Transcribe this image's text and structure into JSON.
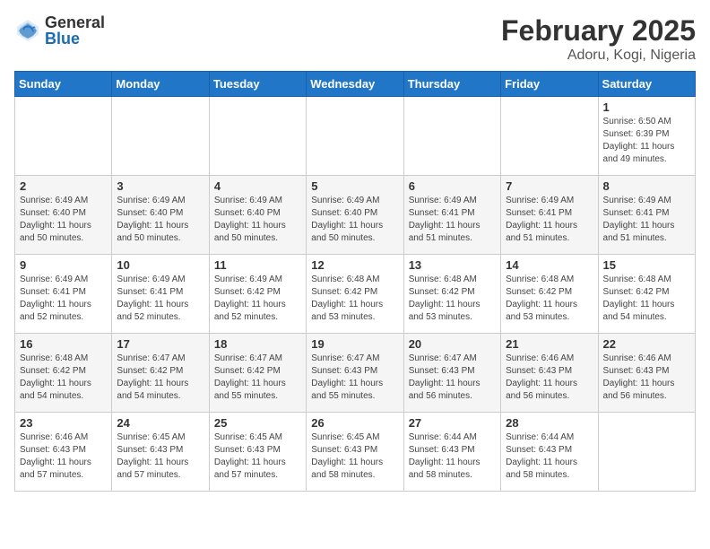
{
  "header": {
    "logo_general": "General",
    "logo_blue": "Blue",
    "month_year": "February 2025",
    "location": "Adoru, Kogi, Nigeria"
  },
  "days_of_week": [
    "Sunday",
    "Monday",
    "Tuesday",
    "Wednesday",
    "Thursday",
    "Friday",
    "Saturday"
  ],
  "weeks": [
    [
      {
        "day": "",
        "info": ""
      },
      {
        "day": "",
        "info": ""
      },
      {
        "day": "",
        "info": ""
      },
      {
        "day": "",
        "info": ""
      },
      {
        "day": "",
        "info": ""
      },
      {
        "day": "",
        "info": ""
      },
      {
        "day": "1",
        "info": "Sunrise: 6:50 AM\nSunset: 6:39 PM\nDaylight: 11 hours\nand 49 minutes."
      }
    ],
    [
      {
        "day": "2",
        "info": "Sunrise: 6:49 AM\nSunset: 6:40 PM\nDaylight: 11 hours\nand 50 minutes."
      },
      {
        "day": "3",
        "info": "Sunrise: 6:49 AM\nSunset: 6:40 PM\nDaylight: 11 hours\nand 50 minutes."
      },
      {
        "day": "4",
        "info": "Sunrise: 6:49 AM\nSunset: 6:40 PM\nDaylight: 11 hours\nand 50 minutes."
      },
      {
        "day": "5",
        "info": "Sunrise: 6:49 AM\nSunset: 6:40 PM\nDaylight: 11 hours\nand 50 minutes."
      },
      {
        "day": "6",
        "info": "Sunrise: 6:49 AM\nSunset: 6:41 PM\nDaylight: 11 hours\nand 51 minutes."
      },
      {
        "day": "7",
        "info": "Sunrise: 6:49 AM\nSunset: 6:41 PM\nDaylight: 11 hours\nand 51 minutes."
      },
      {
        "day": "8",
        "info": "Sunrise: 6:49 AM\nSunset: 6:41 PM\nDaylight: 11 hours\nand 51 minutes."
      }
    ],
    [
      {
        "day": "9",
        "info": "Sunrise: 6:49 AM\nSunset: 6:41 PM\nDaylight: 11 hours\nand 52 minutes."
      },
      {
        "day": "10",
        "info": "Sunrise: 6:49 AM\nSunset: 6:41 PM\nDaylight: 11 hours\nand 52 minutes."
      },
      {
        "day": "11",
        "info": "Sunrise: 6:49 AM\nSunset: 6:42 PM\nDaylight: 11 hours\nand 52 minutes."
      },
      {
        "day": "12",
        "info": "Sunrise: 6:48 AM\nSunset: 6:42 PM\nDaylight: 11 hours\nand 53 minutes."
      },
      {
        "day": "13",
        "info": "Sunrise: 6:48 AM\nSunset: 6:42 PM\nDaylight: 11 hours\nand 53 minutes."
      },
      {
        "day": "14",
        "info": "Sunrise: 6:48 AM\nSunset: 6:42 PM\nDaylight: 11 hours\nand 53 minutes."
      },
      {
        "day": "15",
        "info": "Sunrise: 6:48 AM\nSunset: 6:42 PM\nDaylight: 11 hours\nand 54 minutes."
      }
    ],
    [
      {
        "day": "16",
        "info": "Sunrise: 6:48 AM\nSunset: 6:42 PM\nDaylight: 11 hours\nand 54 minutes."
      },
      {
        "day": "17",
        "info": "Sunrise: 6:47 AM\nSunset: 6:42 PM\nDaylight: 11 hours\nand 54 minutes."
      },
      {
        "day": "18",
        "info": "Sunrise: 6:47 AM\nSunset: 6:42 PM\nDaylight: 11 hours\nand 55 minutes."
      },
      {
        "day": "19",
        "info": "Sunrise: 6:47 AM\nSunset: 6:43 PM\nDaylight: 11 hours\nand 55 minutes."
      },
      {
        "day": "20",
        "info": "Sunrise: 6:47 AM\nSunset: 6:43 PM\nDaylight: 11 hours\nand 56 minutes."
      },
      {
        "day": "21",
        "info": "Sunrise: 6:46 AM\nSunset: 6:43 PM\nDaylight: 11 hours\nand 56 minutes."
      },
      {
        "day": "22",
        "info": "Sunrise: 6:46 AM\nSunset: 6:43 PM\nDaylight: 11 hours\nand 56 minutes."
      }
    ],
    [
      {
        "day": "23",
        "info": "Sunrise: 6:46 AM\nSunset: 6:43 PM\nDaylight: 11 hours\nand 57 minutes."
      },
      {
        "day": "24",
        "info": "Sunrise: 6:45 AM\nSunset: 6:43 PM\nDaylight: 11 hours\nand 57 minutes."
      },
      {
        "day": "25",
        "info": "Sunrise: 6:45 AM\nSunset: 6:43 PM\nDaylight: 11 hours\nand 57 minutes."
      },
      {
        "day": "26",
        "info": "Sunrise: 6:45 AM\nSunset: 6:43 PM\nDaylight: 11 hours\nand 58 minutes."
      },
      {
        "day": "27",
        "info": "Sunrise: 6:44 AM\nSunset: 6:43 PM\nDaylight: 11 hours\nand 58 minutes."
      },
      {
        "day": "28",
        "info": "Sunrise: 6:44 AM\nSunset: 6:43 PM\nDaylight: 11 hours\nand 58 minutes."
      },
      {
        "day": "",
        "info": ""
      }
    ]
  ]
}
